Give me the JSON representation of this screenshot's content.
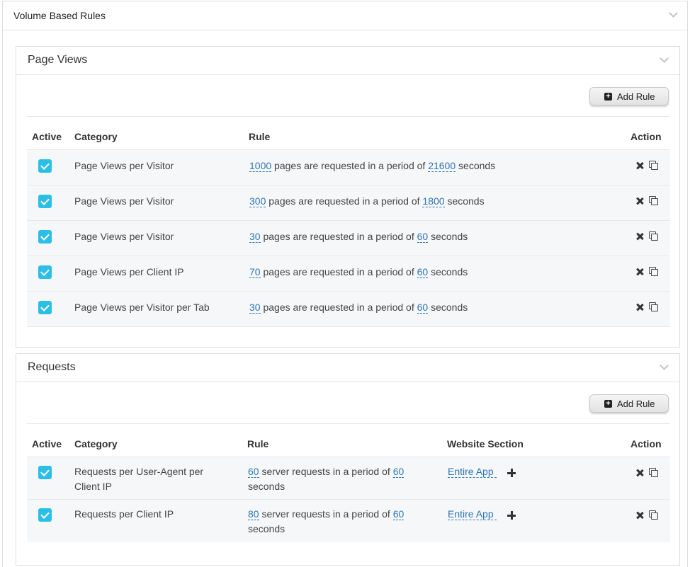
{
  "volume_section": {
    "title": "Volume Based Rules"
  },
  "page_views": {
    "title": "Page Views",
    "add_rule_label": "Add Rule",
    "headers": {
      "active": "Active",
      "category": "Category",
      "rule": "Rule",
      "action": "Action"
    },
    "rows": [
      {
        "active": true,
        "category": "Page Views per Visitor",
        "count": "1000",
        "mid": "pages are requested in a period of",
        "period": "21600",
        "unit": "seconds"
      },
      {
        "active": true,
        "category": "Page Views per Visitor",
        "count": "300",
        "mid": "pages are requested in a period of",
        "period": "1800",
        "unit": "seconds"
      },
      {
        "active": true,
        "category": "Page Views per Visitor",
        "count": "30",
        "mid": "pages are requested in a period of",
        "period": "60",
        "unit": "seconds"
      },
      {
        "active": true,
        "category": "Page Views per Client IP",
        "count": "70",
        "mid": "pages are requested in a period of",
        "period": "60",
        "unit": "seconds"
      },
      {
        "active": true,
        "category": "Page Views per Visitor per Tab",
        "count": "30",
        "mid": "pages are requested in a period of",
        "period": "60",
        "unit": "seconds"
      }
    ]
  },
  "requests": {
    "title": "Requests",
    "add_rule_label": "Add Rule",
    "headers": {
      "active": "Active",
      "category": "Category",
      "rule": "Rule",
      "website_section": "Website Section",
      "action": "Action"
    },
    "rows": [
      {
        "active": true,
        "category_line1": "Requests per User-Agent per",
        "category_line2": "Client IP",
        "count": "60",
        "mid": "server requests in a period of",
        "period": "60",
        "unit": "seconds",
        "section": "Entire App"
      },
      {
        "active": true,
        "category_line1": "Requests per Client IP",
        "category_line2": "",
        "count": "80",
        "mid": "server requests in a period of",
        "period": "60",
        "unit": "seconds",
        "section": "Entire App"
      }
    ]
  }
}
